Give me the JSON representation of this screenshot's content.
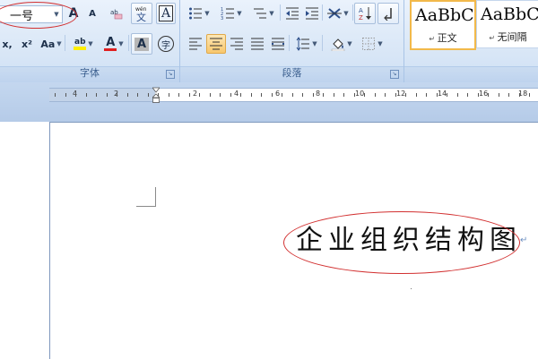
{
  "ribbon": {
    "font_group": {
      "label": "字体",
      "font_size_value": "一号",
      "buttons": {
        "grow_font": "A",
        "shrink_font": "A",
        "phonetic": "wén 文",
        "char_border": "A",
        "subscript": "x",
        "superscript": "x²",
        "change_case": "Aa",
        "highlight": "ab",
        "font_color": "A",
        "char_shading": "A",
        "enclose": "字"
      }
    },
    "paragraph_group": {
      "label": "段落"
    },
    "styles_group": {
      "items": [
        {
          "sample": "AaBbC",
          "name": "正文"
        },
        {
          "sample": "AaBbC",
          "name": "无间隔"
        }
      ]
    }
  },
  "ruler": {
    "labels": [
      "4",
      "2",
      "2",
      "4",
      "6",
      "8",
      "10",
      "12",
      "14",
      "16",
      "18"
    ]
  },
  "document": {
    "title_text": "企业组织结构图",
    "paragraph_mark": "↵"
  },
  "colors": {
    "annotation_ellipse": "#d23030",
    "highlight_yellow": "#ffef00",
    "font_red": "#e02020",
    "ribbon_bg": "#dbe8f7"
  }
}
